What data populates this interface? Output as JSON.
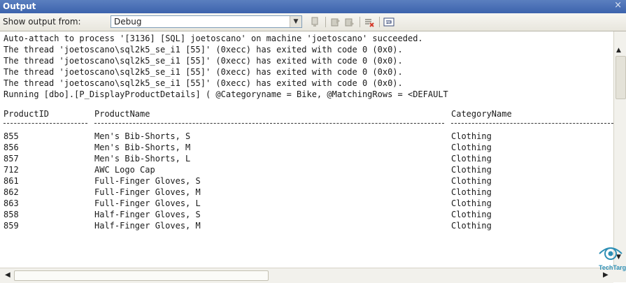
{
  "window": {
    "title": "Output",
    "close_glyph": "×"
  },
  "toolbar": {
    "show_label": "Show output from:",
    "source_selected": "Debug"
  },
  "log_lines": [
    "Auto-attach to process '[3136] [SQL] joetoscano' on machine 'joetoscano' succeeded.",
    "The thread 'joetoscano\\sql2k5_se_i1 [55]' (0xecc) has exited with code 0 (0x0).",
    "The thread 'joetoscano\\sql2k5_se_i1 [55]' (0xecc) has exited with code 0 (0x0).",
    "The thread 'joetoscano\\sql2k5_se_i1 [55]' (0xecc) has exited with code 0 (0x0).",
    "The thread 'joetoscano\\sql2k5_se_i1 [55]' (0xecc) has exited with code 0 (0x0).",
    "Running [dbo].[P_DisplayProductDetails] ( @Categoryname = Bike, @MatchingRows = <DEFAULT"
  ],
  "results": {
    "columns": [
      "ProductID",
      "ProductName",
      "CategoryName"
    ],
    "rows": [
      [
        "855",
        "Men's Bib-Shorts, S",
        "Clothing"
      ],
      [
        "856",
        "Men's Bib-Shorts, M",
        "Clothing"
      ],
      [
        "857",
        "Men's Bib-Shorts, L",
        "Clothing"
      ],
      [
        "712",
        "AWC Logo Cap",
        "Clothing"
      ],
      [
        "861",
        "Full-Finger Gloves, S",
        "Clothing"
      ],
      [
        "862",
        "Full-Finger Gloves, M",
        "Clothing"
      ],
      [
        "863",
        "Full-Finger Gloves, L",
        "Clothing"
      ],
      [
        "858",
        "Half-Finger Gloves, S",
        "Clothing"
      ],
      [
        "859",
        "Half-Finger Gloves, M",
        "Clothing"
      ]
    ]
  },
  "watermark": {
    "brand": "TechTarget"
  },
  "colors": {
    "title_bar": "#3c63ad",
    "toolbar": "#ece9d8",
    "watermark": "#2e8fb5"
  }
}
